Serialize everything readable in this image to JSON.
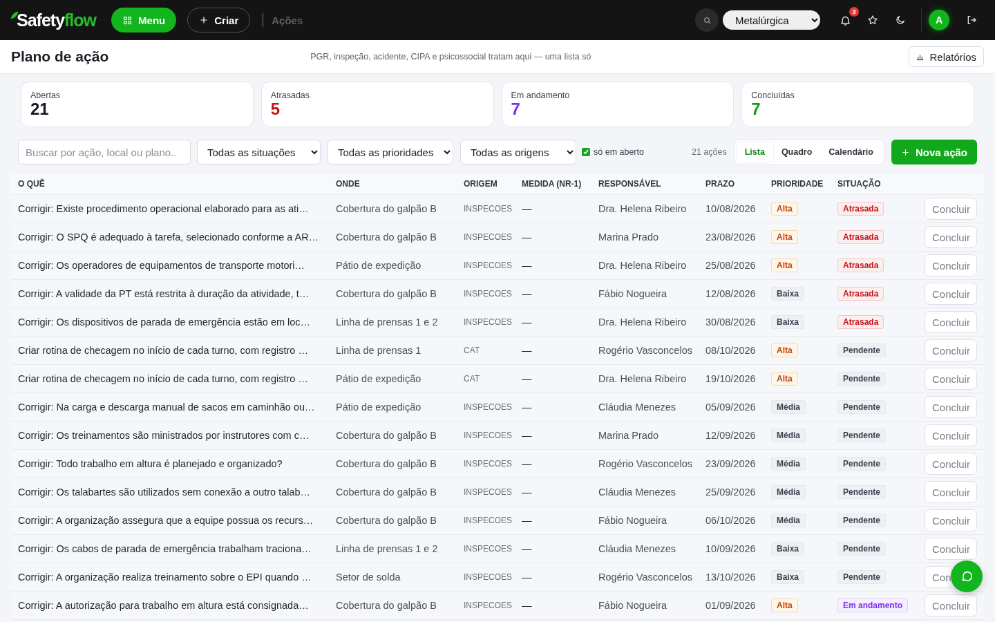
{
  "header": {
    "logo": {
      "text_a": "Safety",
      "text_b": "flow"
    },
    "menu_button": "Menu",
    "create_button": "Criar",
    "breadcrumb": "Ações",
    "company_select": "Metalúrgica",
    "notifications_badge": "3",
    "avatar": "A"
  },
  "title_bar": {
    "title": "Plano de ação",
    "subtitle": "PGR, inspeção, acidente, CIPA e psicossocial tratam aqui — uma lista só",
    "reports_button": "Relatórios"
  },
  "stats": [
    {
      "label": "Abertas",
      "value": "21",
      "kind": "neutral"
    },
    {
      "label": "Atrasadas",
      "value": "5",
      "kind": "late"
    },
    {
      "label": "Em andamento",
      "value": "7",
      "kind": "progress"
    },
    {
      "label": "Concluídas",
      "value": "7",
      "kind": "done"
    }
  ],
  "filters": {
    "search": {
      "placeholder": "Buscar por ação, local ou plano.."
    },
    "selects": [
      "Todas as situações",
      "Todas as prioridades",
      "Todas as origens"
    ],
    "open_only": {
      "label": "só em aberto",
      "checked": true
    },
    "count": "21 ações",
    "views": [
      {
        "label": "Lista",
        "selected": true
      },
      {
        "label": "Quadro",
        "selected": false
      },
      {
        "label": "Calendário",
        "selected": false
      }
    ],
    "new_button": "Nova ação"
  },
  "table": {
    "columns": [
      "O QUÊ",
      "ONDE",
      "ORIGEM",
      "MEDIDA (NR-1)",
      "RESPONSÁVEL",
      "PRAZO",
      "PRIORIDADE",
      "SITUAÇÃO"
    ],
    "rows": [
      {
        "what": "Corrigir: Existe procedimento operacional elaborado para as ati…",
        "where": "Cobertura do galpão B",
        "origin": "INSPECOES",
        "measure": "—",
        "owner": "Dra. Helena Ribeiro",
        "due": "10/08/2026",
        "priority": {
          "text": "Alta",
          "kind": "high"
        },
        "status": {
          "text": "Atrasada",
          "kind": "late"
        },
        "action": "Concluir"
      },
      {
        "what": "Corrigir: O SPQ é adequado à tarefa, selecionado conforme a AR…",
        "where": "Cobertura do galpão B",
        "origin": "INSPECOES",
        "measure": "—",
        "owner": "Marina Prado",
        "due": "23/08/2026",
        "priority": {
          "text": "Alta",
          "kind": "high"
        },
        "status": {
          "text": "Atrasada",
          "kind": "late"
        },
        "action": "Concluir"
      },
      {
        "what": "Corrigir: Os operadores de equipamentos de transporte motori…",
        "where": "Pátio de expedição",
        "origin": "INSPECOES",
        "measure": "—",
        "owner": "Dra. Helena Ribeiro",
        "due": "25/08/2026",
        "priority": {
          "text": "Alta",
          "kind": "high"
        },
        "status": {
          "text": "Atrasada",
          "kind": "late"
        },
        "action": "Concluir"
      },
      {
        "what": "Corrigir: A validade da PT está restrita à duração da atividade, t…",
        "where": "Cobertura do galpão B",
        "origin": "INSPECOES",
        "measure": "—",
        "owner": "Fábio Nogueira",
        "due": "12/08/2026",
        "priority": {
          "text": "Baixa",
          "kind": "low"
        },
        "status": {
          "text": "Atrasada",
          "kind": "late"
        },
        "action": "Concluir"
      },
      {
        "what": "Corrigir: Os dispositivos de parada de emergência estão em loc…",
        "where": "Linha de prensas 1 e 2",
        "origin": "INSPECOES",
        "measure": "—",
        "owner": "Dra. Helena Ribeiro",
        "due": "30/08/2026",
        "priority": {
          "text": "Baixa",
          "kind": "low"
        },
        "status": {
          "text": "Atrasada",
          "kind": "late"
        },
        "action": "Concluir"
      },
      {
        "what": "Criar rotina de checagem no início de cada turno, com registro …",
        "where": "Linha de prensas 1",
        "origin": "CAT",
        "measure": "—",
        "owner": "Rogério Vasconcelos",
        "due": "08/10/2026",
        "priority": {
          "text": "Alta",
          "kind": "high"
        },
        "status": {
          "text": "Pendente",
          "kind": "pending"
        },
        "action": "Concluir"
      },
      {
        "what": "Criar rotina de checagem no início de cada turno, com registro …",
        "where": "Pátio de expedição",
        "origin": "CAT",
        "measure": "—",
        "owner": "Dra. Helena Ribeiro",
        "due": "19/10/2026",
        "priority": {
          "text": "Alta",
          "kind": "high"
        },
        "status": {
          "text": "Pendente",
          "kind": "pending"
        },
        "action": "Concluir"
      },
      {
        "what": "Corrigir: Na carga e descarga manual de sacos em caminhão ou…",
        "where": "Pátio de expedição",
        "origin": "INSPECOES",
        "measure": "—",
        "owner": "Cláudia Menezes",
        "due": "05/09/2026",
        "priority": {
          "text": "Média",
          "kind": "medium"
        },
        "status": {
          "text": "Pendente",
          "kind": "pending"
        },
        "action": "Concluir"
      },
      {
        "what": "Corrigir: Os treinamentos são ministrados por instrutores com c…",
        "where": "Cobertura do galpão B",
        "origin": "INSPECOES",
        "measure": "—",
        "owner": "Marina Prado",
        "due": "12/09/2026",
        "priority": {
          "text": "Média",
          "kind": "medium"
        },
        "status": {
          "text": "Pendente",
          "kind": "pending"
        },
        "action": "Concluir"
      },
      {
        "what": "Corrigir: Todo trabalho em altura é planejado e organizado?",
        "where": "Cobertura do galpão B",
        "origin": "INSPECOES",
        "measure": "—",
        "owner": "Rogério Vasconcelos",
        "due": "23/09/2026",
        "priority": {
          "text": "Média",
          "kind": "medium"
        },
        "status": {
          "text": "Pendente",
          "kind": "pending"
        },
        "action": "Concluir"
      },
      {
        "what": "Corrigir: Os talabartes são utilizados sem conexão a outro talab…",
        "where": "Cobertura do galpão B",
        "origin": "INSPECOES",
        "measure": "—",
        "owner": "Cláudia Menezes",
        "due": "25/09/2026",
        "priority": {
          "text": "Média",
          "kind": "medium"
        },
        "status": {
          "text": "Pendente",
          "kind": "pending"
        },
        "action": "Concluir"
      },
      {
        "what": "Corrigir: A organização assegura que a equipe possua os recurs…",
        "where": "Cobertura do galpão B",
        "origin": "INSPECOES",
        "measure": "—",
        "owner": "Fábio Nogueira",
        "due": "06/10/2026",
        "priority": {
          "text": "Média",
          "kind": "medium"
        },
        "status": {
          "text": "Pendente",
          "kind": "pending"
        },
        "action": "Concluir"
      },
      {
        "what": "Corrigir: Os cabos de parada de emergência trabalham traciona…",
        "where": "Linha de prensas 1 e 2",
        "origin": "INSPECOES",
        "measure": "—",
        "owner": "Cláudia Menezes",
        "due": "10/09/2026",
        "priority": {
          "text": "Baixa",
          "kind": "low"
        },
        "status": {
          "text": "Pendente",
          "kind": "pending"
        },
        "action": "Concluir"
      },
      {
        "what": "Corrigir: A organização realiza treinamento sobre o EPI quando …",
        "where": "Setor de solda",
        "origin": "INSPECOES",
        "measure": "—",
        "owner": "Rogério Vasconcelos",
        "due": "13/10/2026",
        "priority": {
          "text": "Baixa",
          "kind": "low"
        },
        "status": {
          "text": "Pendente",
          "kind": "pending"
        },
        "action": "Con",
        "covered": true
      },
      {
        "what": "Corrigir: A autorização para trabalho em altura está consignada…",
        "where": "Cobertura do galpão B",
        "origin": "INSPECOES",
        "measure": "—",
        "owner": "Fábio Nogueira",
        "due": "01/09/2026",
        "priority": {
          "text": "Alta",
          "kind": "high"
        },
        "status": {
          "text": "Em andamento",
          "kind": "progress"
        },
        "action": "Concluir"
      }
    ]
  }
}
